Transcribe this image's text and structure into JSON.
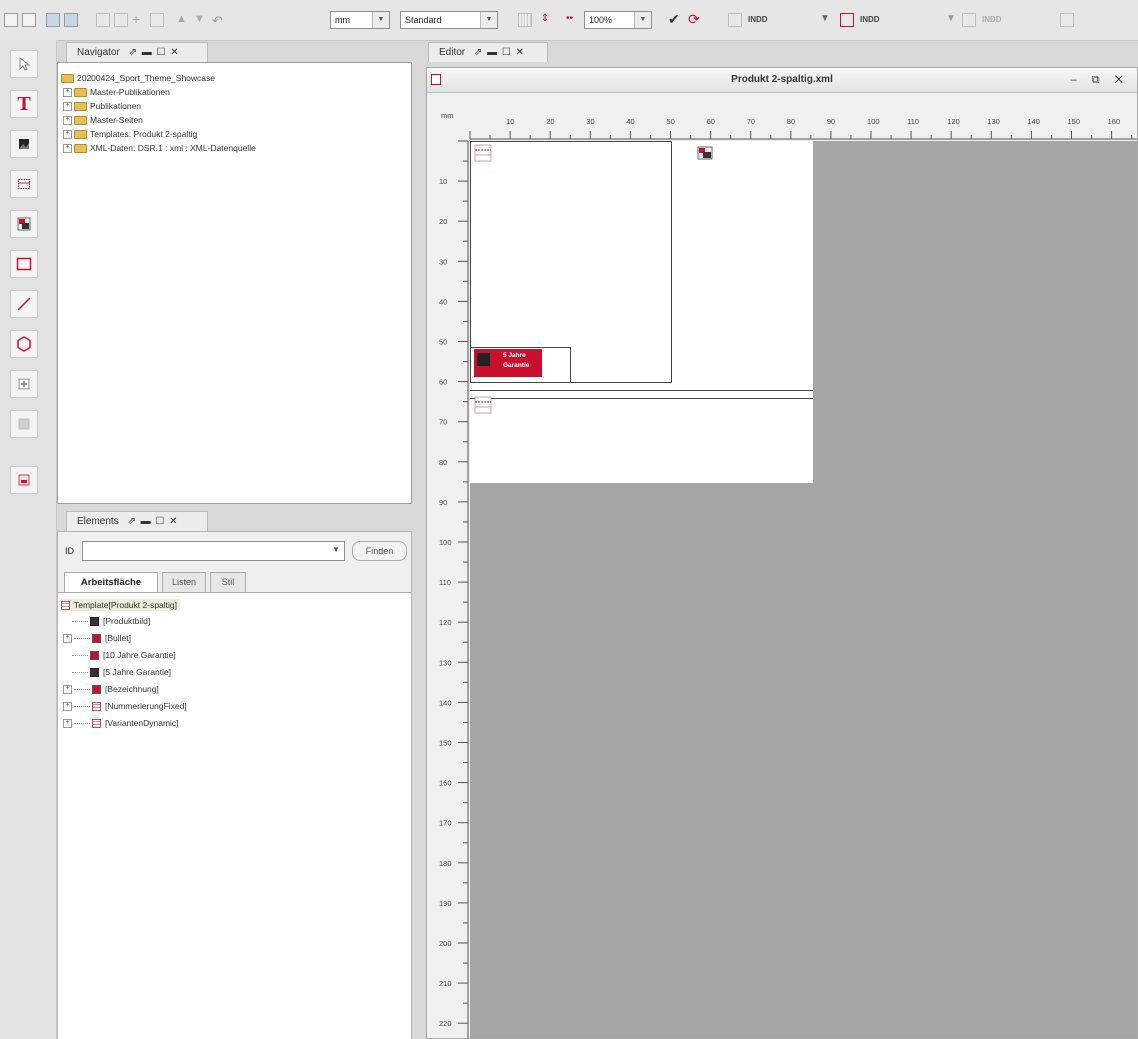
{
  "toolbar": {
    "unit_value": "mm",
    "style_value": "Standard",
    "zoom_value": "100%",
    "indd_1": "INDD",
    "indd_2": "INDD",
    "indd_3": "INDD"
  },
  "navigator": {
    "tab_label": "Navigator",
    "root": "20200424_Sport_Theme_Showcase",
    "items": [
      "Master-Publikationen",
      "Publikationen",
      "Master-Seiten",
      "Templates: Produkt 2-spaltig",
      "XML-Daten: DSR.1 : xml : XML-Datenquelle"
    ]
  },
  "elements": {
    "tab_label": "Elements",
    "id_label": "ID",
    "find_button": "Finden",
    "subtabs": [
      "Arbeitsfläche",
      "Listen",
      "Stil"
    ],
    "root": "Template[Produkt 2-spaltig]",
    "items": [
      {
        "label": "[Produktbild]",
        "icon": "image-icon",
        "expandable": false
      },
      {
        "label": "[Bullet]",
        "icon": "bullet-icon",
        "expandable": true
      },
      {
        "label": "[10 Jahre Garantie]",
        "icon": "bullet-icon",
        "expandable": false
      },
      {
        "label": "[5 Jahre Garantie]",
        "icon": "image-icon",
        "expandable": false
      },
      {
        "label": "[Bezeichnung]",
        "icon": "bullet-icon",
        "expandable": true
      },
      {
        "label": "[NummerierungFixed]",
        "icon": "table-icon",
        "expandable": true
      },
      {
        "label": "[VariantenDynamic]",
        "icon": "table-icon",
        "expandable": true
      }
    ]
  },
  "editor": {
    "tab_label": "Editor",
    "doc_title": "Produkt 2-spaltig.xml",
    "ruler_unit": "mm",
    "h_ticks": [
      "10",
      "20",
      "30",
      "40",
      "50",
      "60",
      "70",
      "80",
      "90",
      "100",
      "110",
      "120",
      "130",
      "140",
      "150",
      "160"
    ],
    "v_ticks": [
      "10",
      "20",
      "30",
      "40",
      "50",
      "60",
      "70",
      "80",
      "90",
      "100",
      "110",
      "120",
      "130",
      "140",
      "150",
      "160",
      "170",
      "180",
      "190",
      "200",
      "210",
      "220"
    ],
    "badge_line1": "5 Jahre",
    "badge_line2": "Garantie"
  },
  "colors": {
    "accent_red": "#c8102e",
    "canvas_gray": "#a6a6a6"
  }
}
